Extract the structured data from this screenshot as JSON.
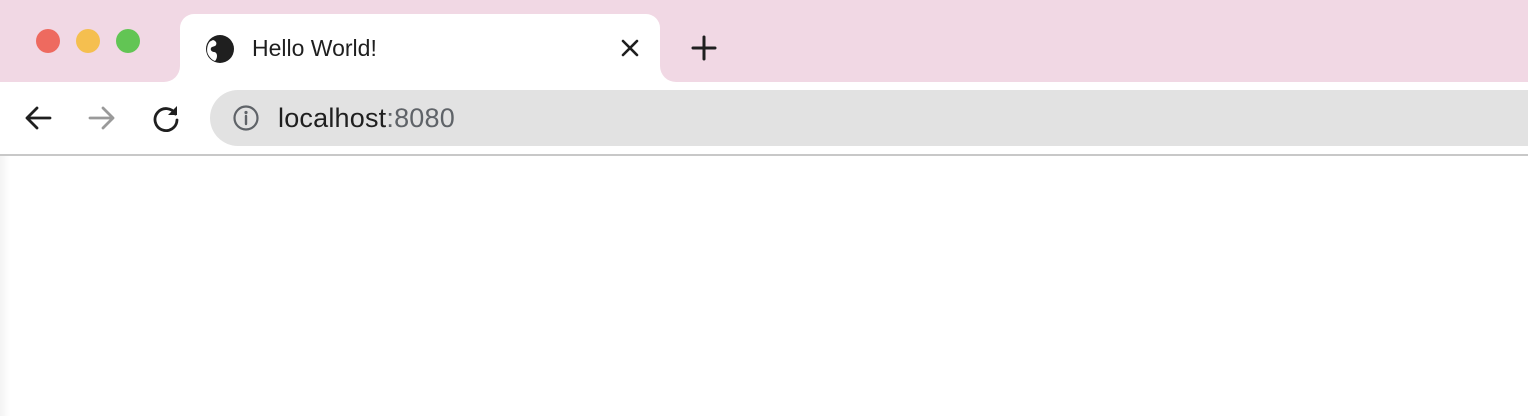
{
  "window": {
    "traffic_lights": {
      "close_color": "#ee6a5f",
      "minimize_color": "#f5bf4f",
      "maximize_color": "#62c554"
    },
    "tabstrip_color": "#f1d8e4"
  },
  "tab": {
    "title": "Hello World!",
    "favicon": "globe-icon",
    "close_icon": "close-icon"
  },
  "new_tab": {
    "icon": "plus-icon"
  },
  "toolbar": {
    "back_icon": "arrow-left-icon",
    "forward_icon": "arrow-right-icon",
    "forward_enabled": false,
    "reload_icon": "reload-icon"
  },
  "omnibox": {
    "site_info_icon": "info-icon",
    "host": "localhost",
    "port": ":8080"
  }
}
